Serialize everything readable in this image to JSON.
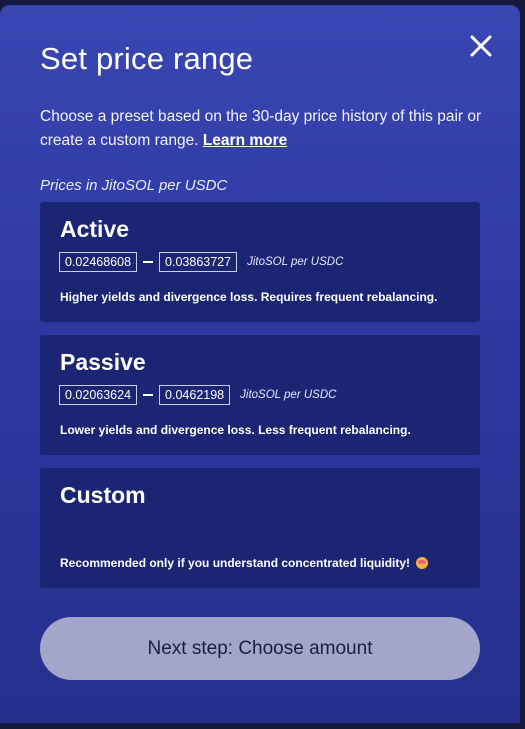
{
  "modal": {
    "title": "Set price range",
    "description": "Choose a preset based on the 30-day price history of this pair or create a custom range.",
    "learn_more": "Learn more",
    "units_caption": "Prices in JitoSOL per USDC"
  },
  "cards": [
    {
      "title": "Active",
      "min": "0.02468608",
      "max": "0.03863727",
      "unit": "JitoSOL per USDC",
      "description": "Higher yields and divergence loss. Requires frequent rebalancing."
    },
    {
      "title": "Passive",
      "min": "0.02063624",
      "max": "0.0462198",
      "unit": "JitoSOL per USDC",
      "description": "Lower yields and divergence loss. Less frequent rebalancing."
    },
    {
      "title": "Custom",
      "description": "Recommended only if you understand concentrated liquidity!",
      "emoji": "flushed-face-icon"
    }
  ],
  "next_button": "Next step: Choose amount",
  "close_icon": "close-icon",
  "colors": {
    "modal_gradient_top": "#3a46b3",
    "modal_gradient_bottom": "#24308c",
    "card_bg": "#1c2474",
    "button_bg": "#a3a6cb"
  }
}
